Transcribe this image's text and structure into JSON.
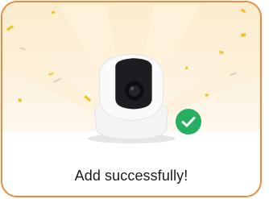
{
  "dialog": {
    "message": "Add successfully!"
  },
  "icons": {
    "device": "security-camera-icon",
    "status": "success-check-icon"
  },
  "colors": {
    "card_border": "#ef8a3c",
    "success_badge": "#27ae60",
    "confetti": "#f3c218",
    "hero_background": "#fbeccd"
  }
}
